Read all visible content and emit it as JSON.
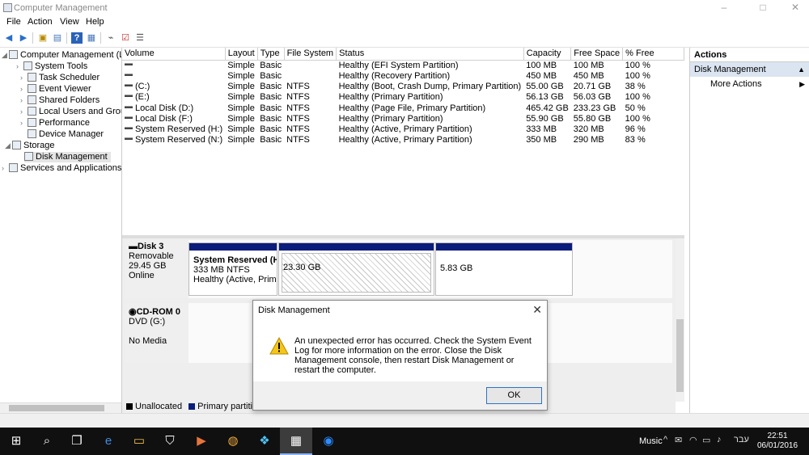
{
  "window": {
    "title": "Computer Management",
    "minimize": "–",
    "maximize": "□",
    "close": "✕"
  },
  "menu": [
    "File",
    "Action",
    "View",
    "Help"
  ],
  "tree": {
    "root": "Computer Management (Local",
    "system_tools": "System Tools",
    "task_scheduler": "Task Scheduler",
    "event_viewer": "Event Viewer",
    "shared_folders": "Shared Folders",
    "local_users": "Local Users and Groups",
    "performance": "Performance",
    "device_manager": "Device Manager",
    "storage": "Storage",
    "disk_management": "Disk Management",
    "services": "Services and Applications"
  },
  "volumes": {
    "headers": [
      "Volume",
      "Layout",
      "Type",
      "File System",
      "Status",
      "Capacity",
      "Free Space",
      "% Free"
    ],
    "rows": [
      [
        "",
        "Simple",
        "Basic",
        "",
        "Healthy (EFI System Partition)",
        "100 MB",
        "100 MB",
        "100 %"
      ],
      [
        "",
        "Simple",
        "Basic",
        "",
        "Healthy (Recovery Partition)",
        "450 MB",
        "450 MB",
        "100 %"
      ],
      [
        "(C:)",
        "Simple",
        "Basic",
        "NTFS",
        "Healthy (Boot, Crash Dump, Primary Partition)",
        "55.00 GB",
        "20.71 GB",
        "38 %"
      ],
      [
        "(E:)",
        "Simple",
        "Basic",
        "NTFS",
        "Healthy (Primary Partition)",
        "56.13 GB",
        "56.03 GB",
        "100 %"
      ],
      [
        "Local Disk (D:)",
        "Simple",
        "Basic",
        "NTFS",
        "Healthy (Page File, Primary Partition)",
        "465.42 GB",
        "233.23 GB",
        "50 %"
      ],
      [
        "Local Disk (F:)",
        "Simple",
        "Basic",
        "NTFS",
        "Healthy (Primary Partition)",
        "55.90 GB",
        "55.80 GB",
        "100 %"
      ],
      [
        "System Reserved (H:)",
        "Simple",
        "Basic",
        "NTFS",
        "Healthy (Active, Primary Partition)",
        "333 MB",
        "320 MB",
        "96 %"
      ],
      [
        "System Reserved (N:)",
        "Simple",
        "Basic",
        "NTFS",
        "Healthy (Active, Primary Partition)",
        "350 MB",
        "290 MB",
        "83 %"
      ]
    ]
  },
  "disk3": {
    "name": "Disk 3",
    "type": "Removable",
    "size": "29.45 GB",
    "state": "Online",
    "p1_name": "System Reserved  (H:)",
    "p1_size": "333 MB NTFS",
    "p1_status": "Healthy (Active, Primary",
    "p2": "23.30 GB",
    "p3": "5.83 GB"
  },
  "cdrom": {
    "name": "CD-ROM 0",
    "drive": "DVD (G:)",
    "media": "No Media"
  },
  "legend": {
    "unallocated": "Unallocated",
    "primary": "Primary partition"
  },
  "actions": {
    "header": "Actions",
    "section": "Disk Management",
    "more": "More Actions"
  },
  "dialog": {
    "title": "Disk Management",
    "message": "An unexpected error has occurred. Check the System Event Log for more information on the error. Close the Disk Management console, then restart Disk Management or restart the computer.",
    "ok": "OK"
  },
  "taskbar": {
    "music": "Music",
    "lang": "עבר",
    "time": "22:51",
    "date": "06/01/2016"
  },
  "colors": {
    "primary_partition": "#0b1d7a",
    "unallocated": "#000000",
    "selection": "#dbe5f1"
  }
}
